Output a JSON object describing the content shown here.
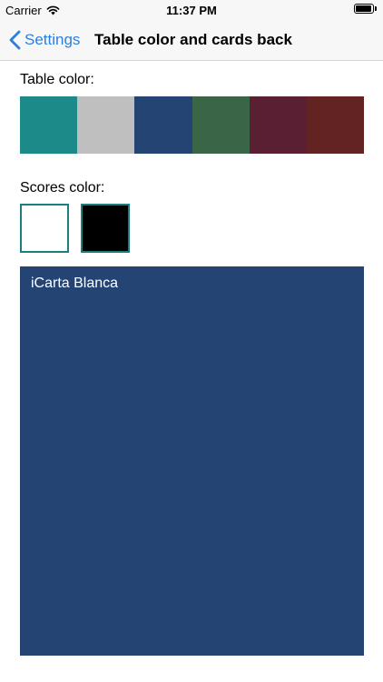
{
  "status_bar": {
    "carrier": "Carrier",
    "time": "11:37 PM",
    "battery_level": 0.95
  },
  "nav": {
    "back_label": "Settings",
    "title": "Table color and cards back"
  },
  "table_color": {
    "label": "Table color:",
    "swatches": [
      "#1b8a88",
      "#bfbfbf",
      "#244474",
      "#3b6547",
      "#5b1f33",
      "#622322"
    ],
    "selected": "#244474"
  },
  "scores_color": {
    "label": "Scores color:",
    "options": [
      "#ffffff",
      "#000000"
    ]
  },
  "preview": {
    "text": "iCarta Blanca",
    "background": "#244474"
  },
  "colors": {
    "accent": "#2a7fe0",
    "selection_border": "#1b7f80"
  }
}
